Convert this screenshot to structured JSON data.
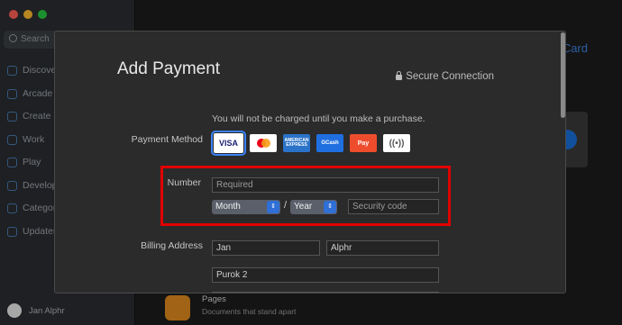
{
  "sidebar": {
    "search_placeholder": "Search",
    "items": [
      {
        "label": "Discover",
        "icon": "star-icon"
      },
      {
        "label": "Arcade",
        "icon": "joystick-icon"
      },
      {
        "label": "Create",
        "icon": "brush-icon"
      },
      {
        "label": "Work",
        "icon": "paperplane-icon"
      },
      {
        "label": "Play",
        "icon": "rocket-icon"
      },
      {
        "label": "Develop",
        "icon": "hammer-icon"
      },
      {
        "label": "Categories",
        "icon": "grid-icon"
      },
      {
        "label": "Updates",
        "icon": "download-icon"
      }
    ],
    "user_name": "Jan Alphr"
  },
  "background": {
    "card_link": "Card",
    "app_title": "Pages",
    "app_subtitle": "Documents that stand apart"
  },
  "sheet": {
    "title": "Add Payment",
    "secure": "Secure Connection",
    "notice": "You will not be charged until you make a purchase.",
    "payment_method_label": "Payment Method",
    "payment_methods": [
      {
        "name": "VISA",
        "selected": true
      },
      {
        "name": "Mastercard",
        "selected": false
      },
      {
        "name": "AMERICAN EXPRESS",
        "selected": false
      },
      {
        "name": "GCash",
        "selected": false
      },
      {
        "name": "Pay",
        "selected": false
      },
      {
        "name": "Contactless",
        "selected": false
      }
    ],
    "number_label": "Number",
    "number_placeholder": "Required",
    "month": "Month",
    "year": "Year",
    "date_separator": "/",
    "security_placeholder": "Security code",
    "billing_label": "Billing Address",
    "first_name": "Jan",
    "last_name": "Alphr",
    "address": "Purok 2"
  },
  "colors": {
    "highlight_box": "#e00000",
    "accent": "#2f6fd6"
  }
}
